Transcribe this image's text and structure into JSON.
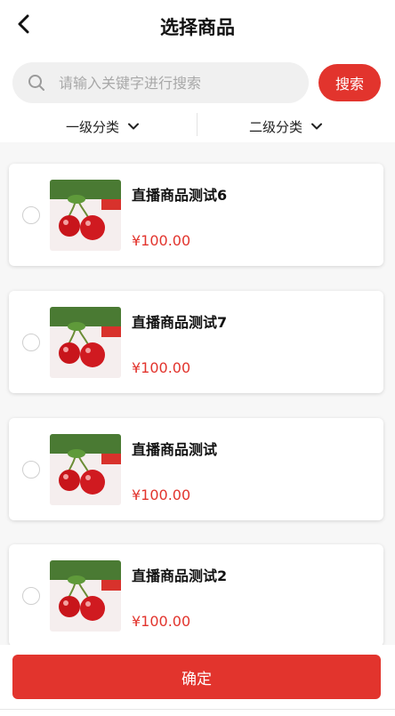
{
  "header": {
    "title": "选择商品",
    "back_icon": "chevron-left-icon"
  },
  "search": {
    "placeholder": "请输入关键字进行搜索",
    "value": "",
    "button_label": "搜索",
    "icon": "search-icon"
  },
  "filters": {
    "level1": "一级分类",
    "level2": "二级分类",
    "chevron_icon": "chevron-down-icon"
  },
  "products": [
    {
      "name": "直播商品测试6",
      "price": "¥100.00",
      "selected": false
    },
    {
      "name": "直播商品测试7",
      "price": "¥100.00",
      "selected": false
    },
    {
      "name": "直播商品测试",
      "price": "¥100.00",
      "selected": false
    },
    {
      "name": "直播商品测试2",
      "price": "¥100.00",
      "selected": false
    }
  ],
  "footer": {
    "confirm_label": "确定"
  },
  "colors": {
    "accent": "#e2342d",
    "background": "#f7f7f7",
    "search_bg": "#f0f0f0"
  }
}
